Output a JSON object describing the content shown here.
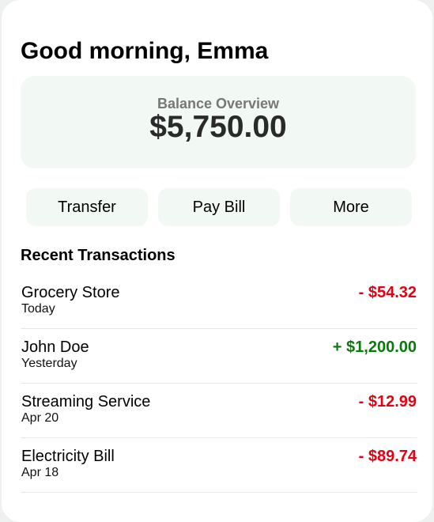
{
  "header": {
    "greeting": "Good morning, Emma"
  },
  "balance": {
    "label": "Balance Overview",
    "amount": "$5,750.00"
  },
  "actions": [
    {
      "label": "Transfer",
      "icon": "transfer"
    },
    {
      "label": "Pay Bill",
      "icon": "bill"
    },
    {
      "label": "More",
      "icon": "more"
    }
  ],
  "transactions_section": {
    "title": "Recent Transactions",
    "items": [
      {
        "name": "Grocery Store",
        "date": "Today",
        "amount": "- $54.32",
        "type": "debit"
      },
      {
        "name": "John Doe",
        "date": "Yesterday",
        "amount": "+ $1,200.00",
        "type": "credit"
      },
      {
        "name": "Streaming Service",
        "date": "Apr 20",
        "amount": "- $12.99",
        "type": "debit"
      },
      {
        "name": "Electricity Bill",
        "date": "Apr 18",
        "amount": "- $89.74",
        "type": "debit"
      }
    ]
  },
  "colors": {
    "card_bg": "#ffffff",
    "tint_bg": "#f2f9f4",
    "debit": "#e60012",
    "credit": "#0a7a0a",
    "muted": "#777777"
  }
}
